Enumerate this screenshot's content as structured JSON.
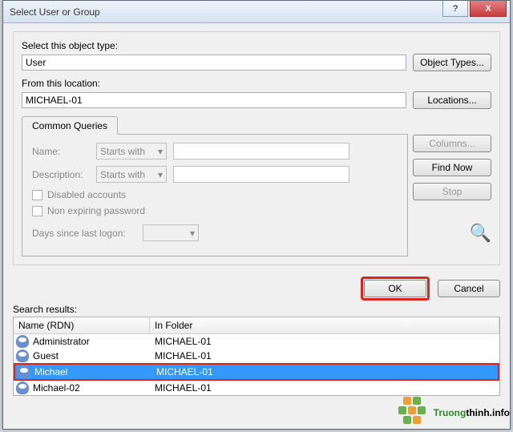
{
  "window": {
    "title": "Select User or Group"
  },
  "section": {
    "object_type_label": "Select this object type:",
    "object_type_value": "User",
    "object_types_btn": "Object Types...",
    "location_label": "From this location:",
    "location_value": "MICHAEL-01",
    "locations_btn": "Locations..."
  },
  "tab": {
    "common_queries": "Common Queries"
  },
  "query": {
    "name_label": "Name:",
    "name_mode": "Starts with",
    "desc_label": "Description:",
    "desc_mode": "Starts with",
    "disabled_accounts": "Disabled accounts",
    "non_expiring": "Non expiring password",
    "days_label": "Days since last logon:"
  },
  "sidebar": {
    "columns": "Columns...",
    "find_now": "Find Now",
    "stop": "Stop"
  },
  "actions": {
    "ok": "OK",
    "cancel": "Cancel"
  },
  "results": {
    "label": "Search results:",
    "col_name": "Name (RDN)",
    "col_folder": "In Folder",
    "rows": [
      {
        "name": "Administrator",
        "folder": "MICHAEL-01"
      },
      {
        "name": "Guest",
        "folder": "MICHAEL-01"
      },
      {
        "name": "Michael",
        "folder": "MICHAEL-01"
      },
      {
        "name": "Michael-02",
        "folder": "MICHAEL-01"
      }
    ]
  },
  "watermark": {
    "brand_green": "Truong",
    "brand_rest": "thinh.info"
  }
}
